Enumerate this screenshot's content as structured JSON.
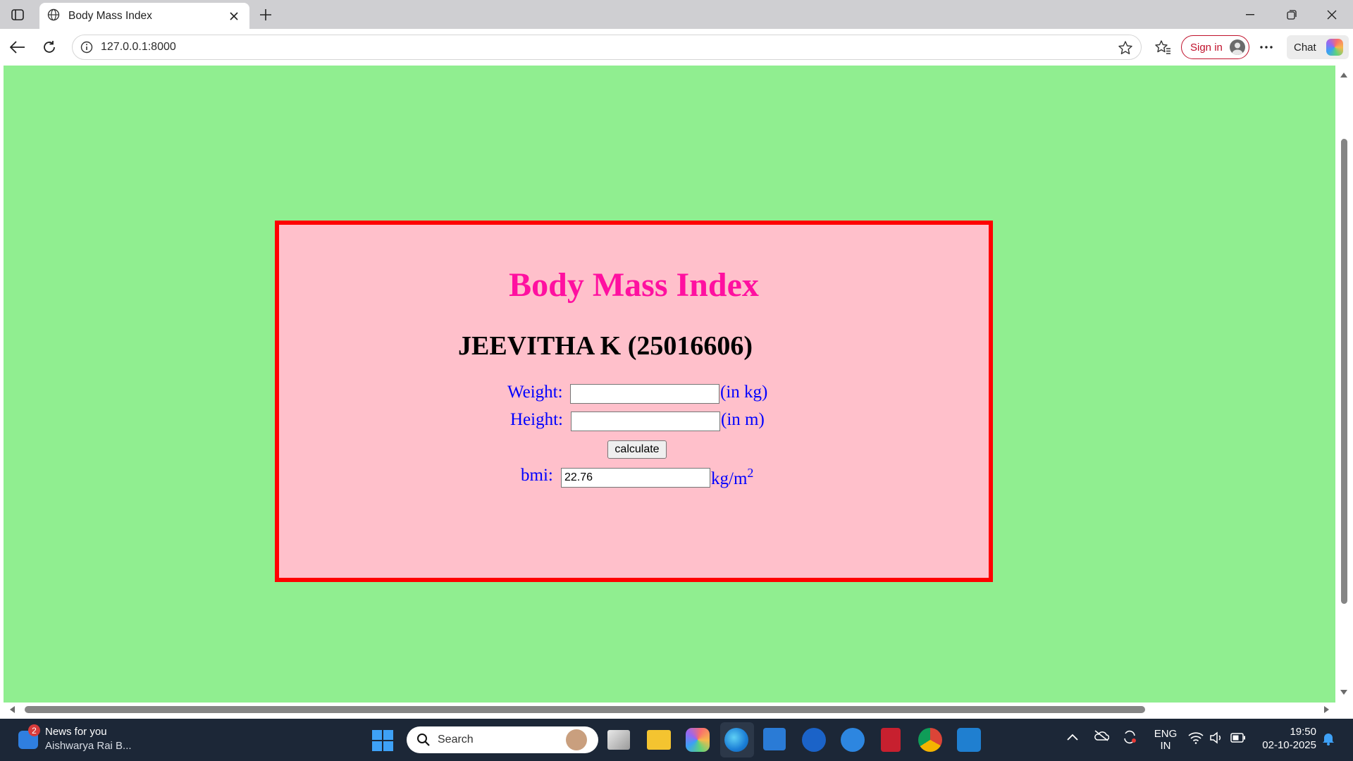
{
  "browser": {
    "tab_title": "Body Mass Index",
    "url": "127.0.0.1:8000",
    "signin_label": "Sign in",
    "chat_label": "Chat"
  },
  "page": {
    "heading": "Body Mass Index",
    "subheading": "JEEVITHA K (25016606)",
    "weight_label": "Weight:",
    "weight_value": "",
    "weight_unit": "(in kg)",
    "height_label": "Height:",
    "height_value": "",
    "height_unit": "(in m)",
    "calculate_label": "calculate",
    "bmi_label": "bmi:",
    "bmi_value": "22.76",
    "bmi_unit": "kg/m",
    "bmi_unit_sup": "2",
    "colors": {
      "background": "#90ee90",
      "box_background": "#ffc0cb",
      "box_border": "#ff0000",
      "heading": "#ff10a0",
      "labels": "#0000ff"
    }
  },
  "taskbar": {
    "news_badge": "2",
    "news_title": "News for you",
    "news_subtitle": "Aishwarya Rai B...",
    "search_label": "Search",
    "language_top": "ENG",
    "language_bottom": "IN",
    "time": "19:50",
    "date": "02-10-2025",
    "apps": [
      "task-view",
      "file-explorer",
      "copilot",
      "edge",
      "store",
      "hp",
      "help",
      "mcafee",
      "chrome",
      "vscode"
    ]
  }
}
